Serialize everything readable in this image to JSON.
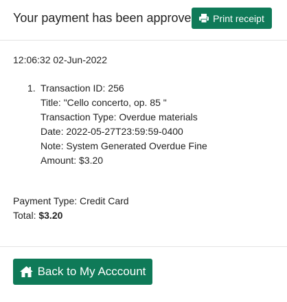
{
  "header": {
    "approved_message": "Your payment has been approved.",
    "print_label": "Print receipt",
    "print_icon": "printer-icon"
  },
  "receipt": {
    "timestamp": "12:06:32 02-Jun-2022",
    "transactions": [
      {
        "number": "1.",
        "transaction_id": "Transaction ID: 256",
        "title": "Title: \"Cello concerto, op. 85 \"",
        "transaction_type": "Transaction Type: Overdue materials",
        "date": "Date: 2022-05-27T23:59:59-0400",
        "note": "Note: System Generated Overdue Fine",
        "amount": "Amount: $3.20"
      }
    ],
    "payment_type": "Payment Type: Credit Card",
    "total_label": "Total: ",
    "total_value": "$3.20"
  },
  "footer": {
    "back_label": "Back to My Acccount",
    "back_icon": "home-icon"
  },
  "colors": {
    "button_bg": "#0f7a58",
    "button_text": "#ffffff",
    "divider": "#e3e3e3"
  }
}
